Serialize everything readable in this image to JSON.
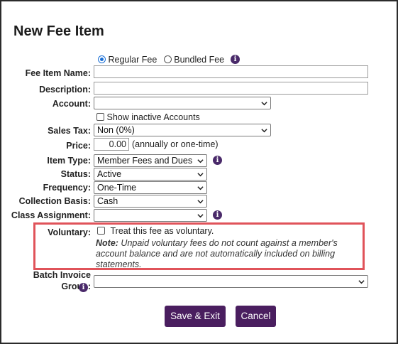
{
  "title": "New Fee Item",
  "fee_type": {
    "regular_label": "Regular Fee",
    "bundled_label": "Bundled Fee",
    "selected": "Regular Fee"
  },
  "labels": {
    "fee_item_name": "Fee Item Name:",
    "description": "Description:",
    "account": "Account:",
    "show_inactive": "Show inactive Accounts",
    "sales_tax": "Sales Tax:",
    "price": "Price:",
    "price_hint": "(annually or one-time)",
    "item_type": "Item Type:",
    "status": "Status:",
    "frequency": "Frequency:",
    "collection_basis": "Collection Basis:",
    "class_assignment": "Class Assignment:",
    "voluntary": "Voluntary:",
    "voluntary_checkbox": "Treat this fee as voluntary.",
    "note_bold": "Note:",
    "note_text": " Unpaid voluntary fees do not count against a member's account balance and are not automatically included on billing statements.",
    "batch_invoice_group_line1": "Batch Invoice",
    "batch_invoice_group_line2": "Group:"
  },
  "values": {
    "fee_item_name": "",
    "description": "",
    "account": "",
    "sales_tax": "Non (0%)",
    "price": "0.00",
    "item_type": "Member Fees and Dues",
    "status": "Active",
    "frequency": "One-Time",
    "collection_basis": "Cash",
    "class_assignment": "",
    "batch_invoice_group": ""
  },
  "buttons": {
    "save": "Save & Exit",
    "cancel": "Cancel"
  },
  "colors": {
    "accent": "#4a1e5f",
    "highlight_border": "#e0535a",
    "radio_selected": "#1a6fd6"
  }
}
